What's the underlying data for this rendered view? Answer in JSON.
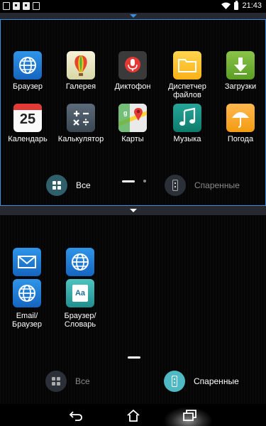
{
  "status_bar": {
    "time": "21:43",
    "left_icons": [
      "notification-icon",
      "image-icon",
      "qr-icon",
      "store-icon"
    ],
    "right_icons": [
      "wifi-icon",
      "battery-icon"
    ]
  },
  "top_panel": {
    "apps": [
      {
        "name": "browser",
        "label": "Браузер",
        "icon": "globe-icon"
      },
      {
        "name": "gallery",
        "label": "Галерея",
        "icon": "balloon-icon"
      },
      {
        "name": "recorder",
        "label": "Диктофон",
        "icon": "microphone-icon"
      },
      {
        "name": "file-manager",
        "label": "Диспетчер файлов",
        "icon": "folder-icon"
      },
      {
        "name": "downloads",
        "label": "Загрузки",
        "icon": "download-icon"
      },
      {
        "name": "calendar",
        "label": "Календарь",
        "icon": "calendar-icon",
        "calendar_day": "25"
      },
      {
        "name": "calculator",
        "label": "Калькулятор",
        "icon": "calculator-icon"
      },
      {
        "name": "maps",
        "label": "Карты",
        "icon": "maps-icon"
      },
      {
        "name": "music",
        "label": "Музыка",
        "icon": "music-icon"
      },
      {
        "name": "weather",
        "label": "Погода",
        "icon": "umbrella-icon"
      }
    ],
    "pager": {
      "pages": 2,
      "current": 1
    },
    "tabs": {
      "all_label": "Все",
      "paired_label": "Спаренные",
      "active": "all"
    }
  },
  "bottom_panel": {
    "pairs": [
      {
        "name": "email-browser",
        "label": "Email/ Браузер",
        "icons": [
          "mail-icon",
          "globe-icon"
        ]
      },
      {
        "name": "browser-dictionary",
        "label": "Браузер/ Словарь",
        "icons": [
          "globe-icon",
          "dictionary-icon"
        ],
        "dictionary_glyph": "Aa"
      }
    ],
    "tabs": {
      "all_label": "Все",
      "paired_label": "Спаренные",
      "active": "paired"
    }
  },
  "nav_bar": {
    "buttons": [
      "back-icon",
      "home-icon",
      "recent-apps-icon"
    ]
  },
  "colors": {
    "accent": "#3a8edc",
    "tab_icon_bg": "#2b3a44",
    "tab_icon_active": "#4fb9c4"
  }
}
